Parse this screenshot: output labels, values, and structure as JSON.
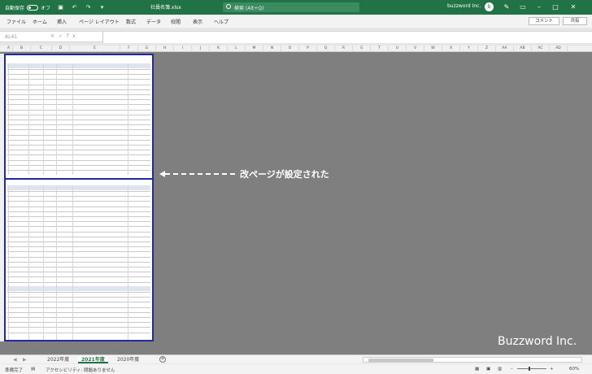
{
  "titlebar": {
    "autosave_label": "自動保存",
    "autosave_state": "オフ",
    "filename": "社員名簿.xlsx",
    "search_placeholder": "検索 (Alt+Q)",
    "user_name": "buzzword Inc.",
    "colors": {
      "bar": "#217346"
    }
  },
  "ribbon": {
    "tabs": [
      "ファイル",
      "ホーム",
      "挿入",
      "ページ レイアウト",
      "数式",
      "データ",
      "校閲",
      "表示",
      "ヘルプ"
    ],
    "comment_label": "コメント",
    "share_label": "共有"
  },
  "formula_bar": {
    "name_box": "AL41",
    "fx_label": "fx",
    "value": ""
  },
  "columns": [
    "A",
    "B",
    "C",
    "D",
    "E",
    "F",
    "G",
    "H",
    "I",
    "J",
    "K",
    "L",
    "M",
    "N",
    "O",
    "P",
    "Q",
    "R",
    "S",
    "T",
    "U",
    "V",
    "W",
    "X",
    "Y",
    "Z",
    "AA",
    "AB",
    "AC",
    "AD"
  ],
  "sheet": {
    "page_break_color": "#1f2d9c"
  },
  "annotation": {
    "text": "改ページが設定された"
  },
  "watermark": "Buzzword Inc.",
  "sheet_tabs": {
    "tabs": [
      "2022年度",
      "2021年度",
      "2020年度"
    ],
    "active_index": 1
  },
  "status": {
    "ready": "準備完了",
    "accessibility": "アクセシビリティ: 問題ありません",
    "zoom": "60%"
  }
}
